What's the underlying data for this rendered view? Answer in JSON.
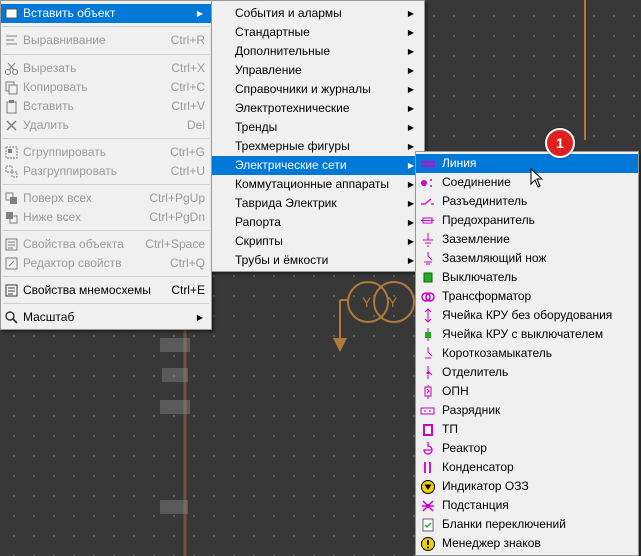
{
  "menu_main": {
    "items": [
      {
        "label": "Вставить объект",
        "shortcut": "",
        "icon": "insert-icon",
        "disabled": false,
        "submenu": true,
        "highlighted": true
      },
      {
        "label": "Выравнивание",
        "shortcut": "Ctrl+R",
        "icon": "align-icon",
        "disabled": true
      },
      {
        "label": "Вырезать",
        "shortcut": "Ctrl+X",
        "icon": "cut-icon",
        "disabled": true
      },
      {
        "label": "Копировать",
        "shortcut": "Ctrl+C",
        "icon": "copy-icon",
        "disabled": true
      },
      {
        "label": "Вставить",
        "shortcut": "Ctrl+V",
        "icon": "paste-icon",
        "disabled": true
      },
      {
        "label": "Удалить",
        "shortcut": "Del",
        "icon": "delete-icon",
        "disabled": true
      },
      {
        "label": "Сгруппировать",
        "shortcut": "Ctrl+G",
        "icon": "group-icon",
        "disabled": true
      },
      {
        "label": "Разгруппировать",
        "shortcut": "Ctrl+U",
        "icon": "ungroup-icon",
        "disabled": true
      },
      {
        "label": "Поверх всех",
        "shortcut": "Ctrl+PgUp",
        "icon": "bring-front-icon",
        "disabled": true
      },
      {
        "label": "Ниже всех",
        "shortcut": "Ctrl+PgDn",
        "icon": "send-back-icon",
        "disabled": true
      },
      {
        "label": "Свойства объекта",
        "shortcut": "Ctrl+Space",
        "icon": "object-properties-icon",
        "disabled": true
      },
      {
        "label": "Редактор свойств",
        "shortcut": "Ctrl+Q",
        "icon": "property-editor-icon",
        "disabled": true
      },
      {
        "label": "Свойства мнемосхемы",
        "shortcut": "Ctrl+E",
        "icon": "diagram-properties-icon",
        "disabled": false
      },
      {
        "label": "Масштаб",
        "shortcut": "",
        "icon": "zoom-icon",
        "disabled": false,
        "submenu": true
      }
    ]
  },
  "menu_insert": {
    "items": [
      {
        "label": "События и алармы"
      },
      {
        "label": "Стандартные"
      },
      {
        "label": "Дополнительные"
      },
      {
        "label": "Управление"
      },
      {
        "label": "Справочники и журналы"
      },
      {
        "label": "Электротехнические"
      },
      {
        "label": "Тренды"
      },
      {
        "label": "Трехмерные фигуры"
      },
      {
        "label": "Электрические сети",
        "highlighted": true
      },
      {
        "label": "Коммутационные аппараты"
      },
      {
        "label": "Таврида Электрик"
      },
      {
        "label": "Рапорта"
      },
      {
        "label": "Скрипты"
      },
      {
        "label": "Трубы и ёмкости"
      }
    ]
  },
  "menu_networks": {
    "items": [
      {
        "label": "Линия",
        "icon": "line-icon",
        "highlighted": true
      },
      {
        "label": "Соединение",
        "icon": "connection-icon"
      },
      {
        "label": "Разъединитель",
        "icon": "disconnector-icon"
      },
      {
        "label": "Предохранитель",
        "icon": "fuse-icon"
      },
      {
        "label": "Заземление",
        "icon": "ground-icon"
      },
      {
        "label": "Заземляющий нож",
        "icon": "grounding-knife-icon"
      },
      {
        "label": "Выключатель",
        "icon": "breaker-icon"
      },
      {
        "label": "Трансформатор",
        "icon": "transformer-icon"
      },
      {
        "label": "Ячейка КРУ без оборудования",
        "icon": "cell-empty-icon"
      },
      {
        "label": "Ячейка КРУ с выключателем",
        "icon": "cell-breaker-icon"
      },
      {
        "label": "Короткозамыкатель",
        "icon": "short-circuiter-icon"
      },
      {
        "label": "Отделитель",
        "icon": "separator-icon"
      },
      {
        "label": "ОПН",
        "icon": "surge-arrester-icon"
      },
      {
        "label": "Разрядник",
        "icon": "spark-gap-icon"
      },
      {
        "label": "ТП",
        "icon": "substation-tp-icon"
      },
      {
        "label": "Реактор",
        "icon": "reactor-icon"
      },
      {
        "label": "Конденсатор",
        "icon": "capacitor-icon"
      },
      {
        "label": "Индикатор ОЗЗ",
        "icon": "ozz-indicator-icon"
      },
      {
        "label": "Подстанция",
        "icon": "substation-icon"
      },
      {
        "label": "Бланки переключений",
        "icon": "switching-forms-icon"
      },
      {
        "label": "Менеджер знаков",
        "icon": "sign-manager-icon"
      }
    ]
  },
  "callout": {
    "number": "1"
  },
  "colors": {
    "accent": "#0078d7",
    "element": "#cc00cc",
    "canvas": "#383838",
    "line_art": "#b07a3a"
  }
}
